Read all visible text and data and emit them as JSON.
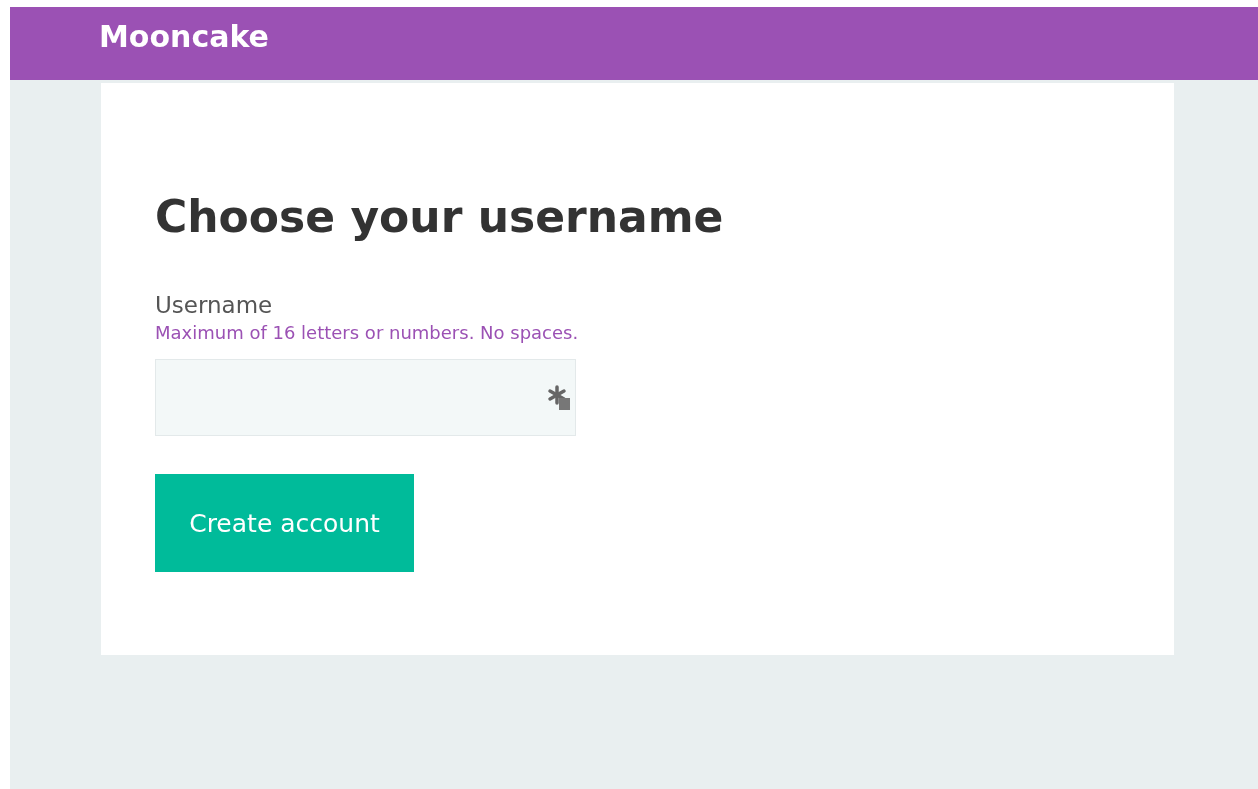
{
  "header": {
    "title": "Mooncake"
  },
  "form": {
    "heading": "Choose your username",
    "field": {
      "label": "Username",
      "hint": "Maximum of 16 letters or numbers. No spaces."
    },
    "button": "Create account"
  }
}
